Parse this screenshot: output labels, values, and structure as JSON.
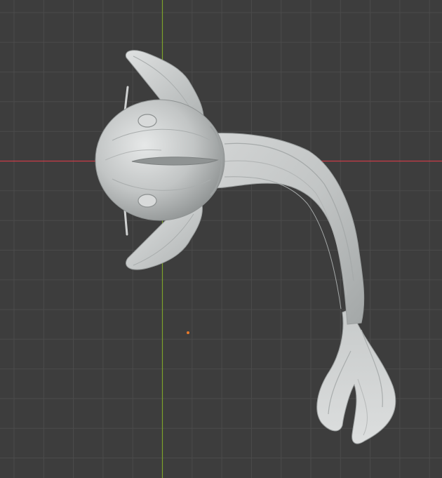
{
  "viewport": {
    "mode": "3d-viewport-top-orthographic",
    "background_color": "#3d3d3d",
    "grid_color": "#4b4b4b",
    "x_axis_color": "#ca3c47",
    "y_axis_color": "#7ca12c",
    "origin_marker_color": "#e87a2a",
    "model_color": "#c9cbcb"
  },
  "scene": {
    "object": "fish-sculpt",
    "object_origin_visible": true
  }
}
